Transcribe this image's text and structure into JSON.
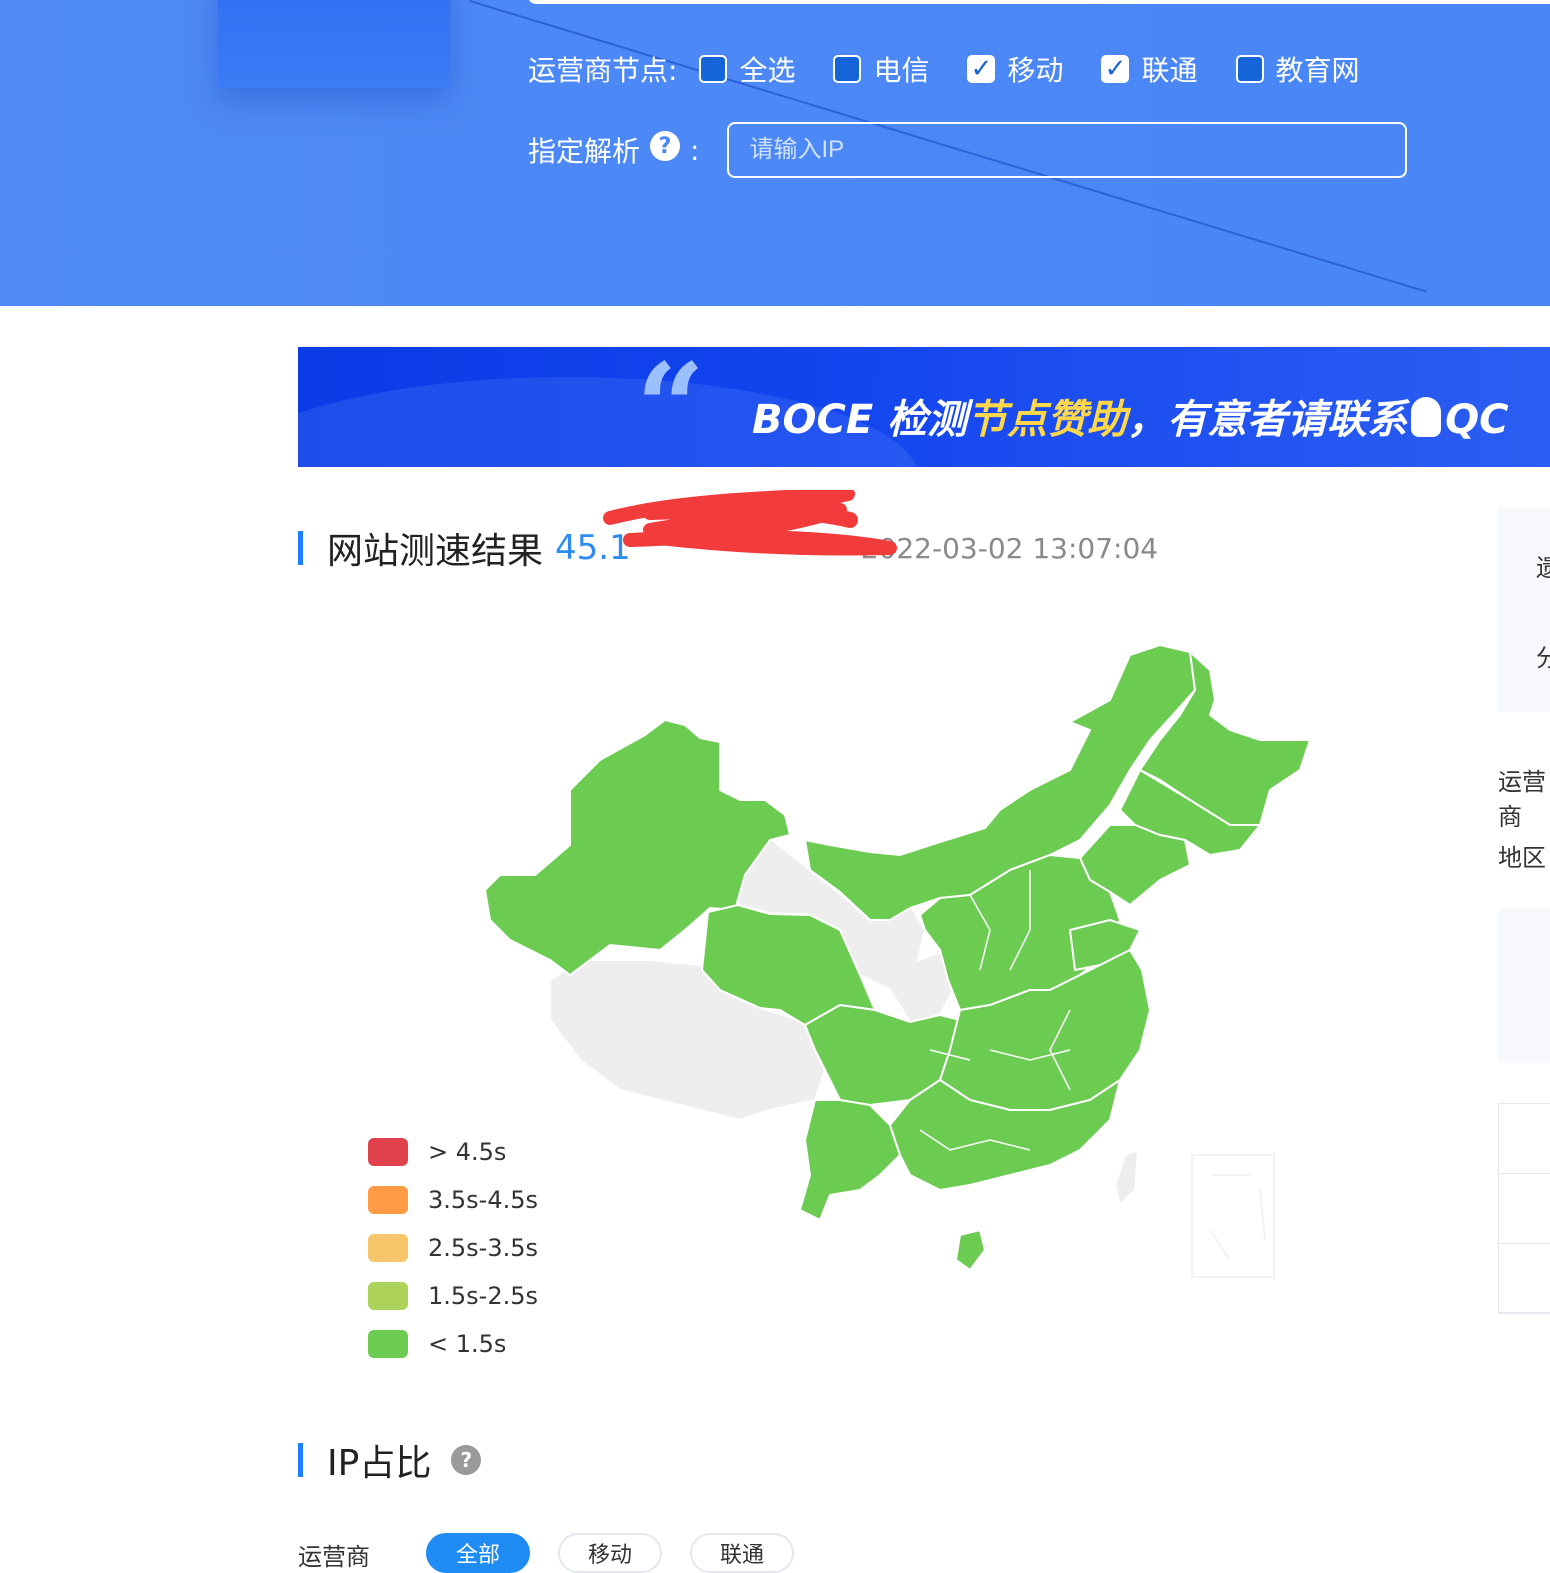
{
  "hero": {
    "carrier_label": "运营商节点:",
    "carriers": [
      {
        "label": "全选",
        "checked": false
      },
      {
        "label": "电信",
        "checked": false
      },
      {
        "label": "移动",
        "checked": true
      },
      {
        "label": "联通",
        "checked": true
      },
      {
        "label": "教育网",
        "checked": false
      }
    ],
    "resolve_label": "指定解析",
    "resolve_colon": ":",
    "ip_placeholder": "请输入IP",
    "ip_value": ""
  },
  "banner": {
    "text_prefix": "BOCE 检测",
    "text_highlight": "节点赞助",
    "text_suffix": "，有意者请联系",
    "text_tail": "QC"
  },
  "result": {
    "title": "网站测速结果",
    "ip_visible": "45.1",
    "time_visible": "2022-03-02 13:07:04"
  },
  "legend": [
    {
      "label": "> 4.5s",
      "color": "#e0414b"
    },
    {
      "label": "3.5s-4.5s",
      "color": "#ff9a45"
    },
    {
      "label": "2.5s-3.5s",
      "color": "#f7c56a"
    },
    {
      "label": "1.5s-2.5s",
      "color": "#aed35a"
    },
    {
      "label": "< 1.5s",
      "color": "#6ccc52"
    }
  ],
  "map": {
    "fast_color": "#6ccc52",
    "nodata_color": "#eeeeee"
  },
  "right_panel": {
    "char1": "遗",
    "char2": "分",
    "label_carrier": "运营商",
    "label_region": "地区"
  },
  "ip_share": {
    "title": "IP占比",
    "filter_label": "运营商",
    "tabs": [
      {
        "label": "全部",
        "active": true
      },
      {
        "label": "移动",
        "active": false
      },
      {
        "label": "联通",
        "active": false
      }
    ]
  }
}
